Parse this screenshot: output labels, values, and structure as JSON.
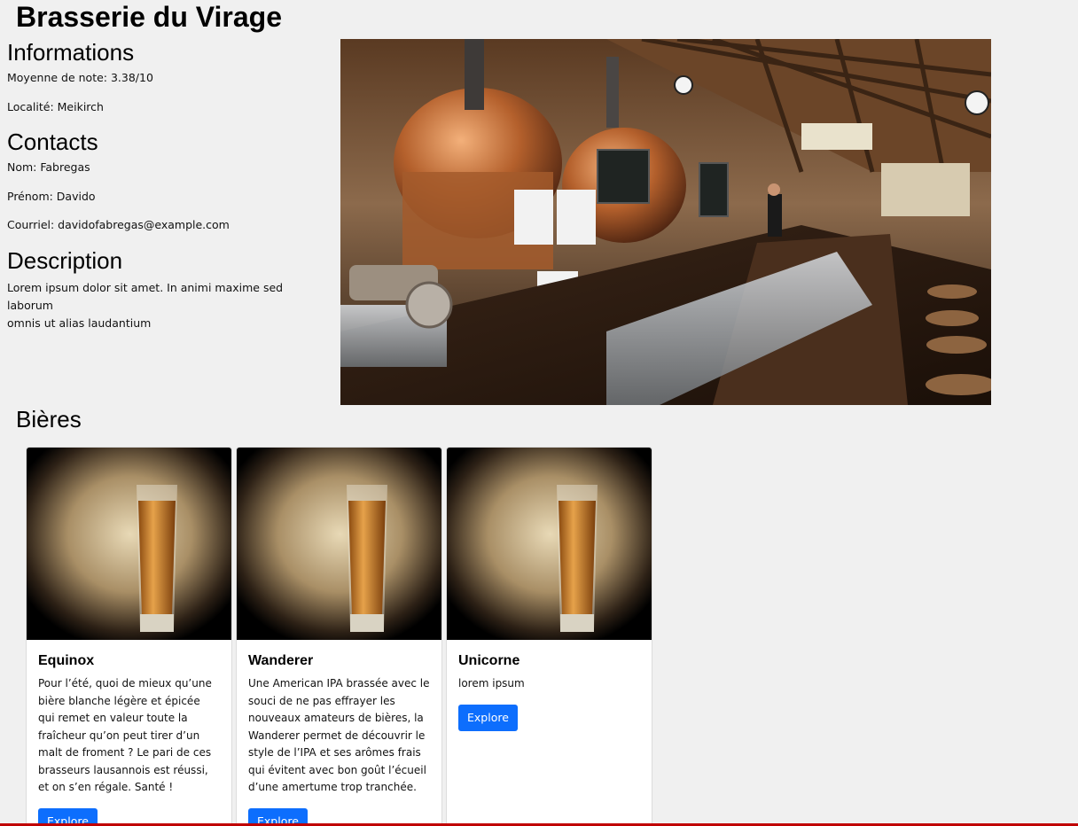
{
  "brewery": {
    "name": "Brasserie du Virage"
  },
  "informations": {
    "heading": "Informations",
    "rating": "Moyenne de note: 3.38/10",
    "locality": "Localité: Meikirch"
  },
  "contacts": {
    "heading": "Contacts",
    "last_name": "Nom: Fabregas",
    "first_name": "Prénom: Davido",
    "email": "Courriel: davidofabregas@example.com"
  },
  "description": {
    "heading": "Description",
    "line1": "Lorem ipsum dolor sit amet. In animi maxime sed laborum",
    "line2": "omnis ut alias laudantium"
  },
  "beers": {
    "heading": "Bières",
    "items": [
      {
        "name": "Equinox",
        "description": "Pour l’été, quoi de mieux qu’une bière blanche légère et épicée qui remet en valeur toute la fraîcheur qu’on peut tirer d’un malt de froment ? Le pari de ces brasseurs lausannois est réussi, et on s’en régale. Santé !",
        "button": "Explore"
      },
      {
        "name": "Wanderer",
        "description": "Une American IPA brassée avec le souci de ne pas effrayer les nouveaux amateurs de bières, la Wanderer permet de découvrir le style de l’IPA et ses arômes frais qui évitent avec bon goût l’écueil d’une amertume trop tranchée.",
        "button": "Explore"
      },
      {
        "name": "Unicorne",
        "description": "lorem ipsum",
        "button": "Explore"
      }
    ]
  },
  "colors": {
    "background": "#f0f0f0",
    "button": "#0d6efd",
    "bottom_bar": "#c00000"
  }
}
